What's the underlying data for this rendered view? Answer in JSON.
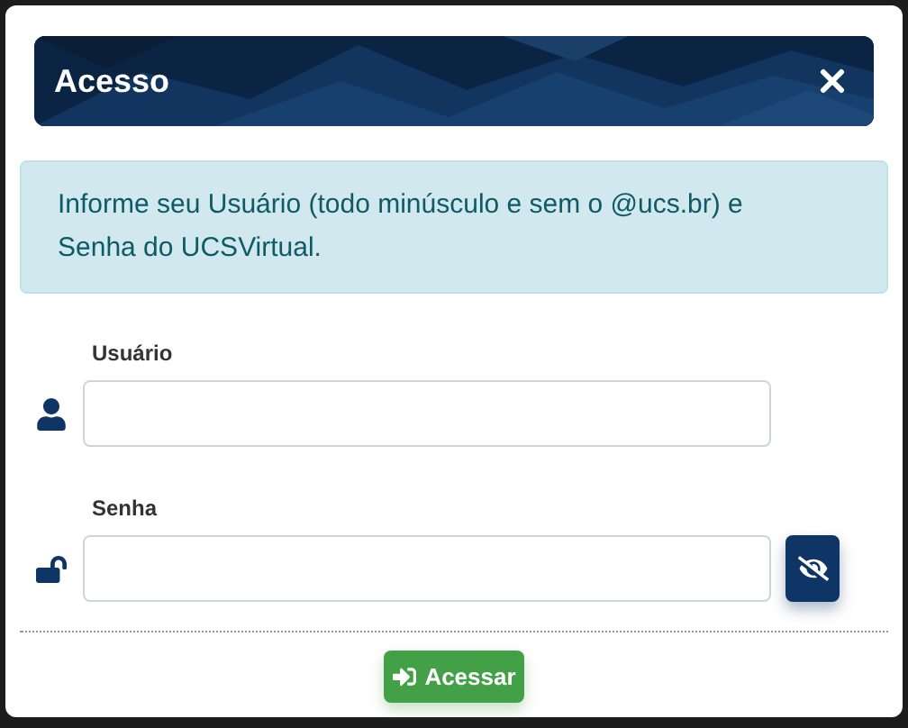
{
  "dialog": {
    "title": "Acesso"
  },
  "info": "Informe seu Usuário (todo minúsculo e sem o @ucs.br) e Senha do UCSVirtual.",
  "fields": [
    {
      "label": "Usuário",
      "kind": "user"
    },
    {
      "label": "Senha",
      "kind": "password"
    }
  ],
  "submit": "Acessar"
}
